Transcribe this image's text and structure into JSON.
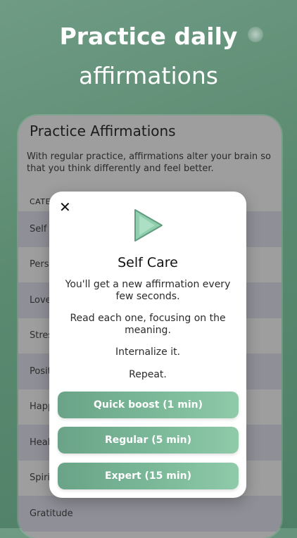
{
  "hero": {
    "line1": "Practice daily",
    "line2": "affirmations"
  },
  "screen": {
    "title": "Practice Affirmations",
    "description": "With regular practice, affirmations alter your brain so that you think differently and feel better.",
    "category_header": "CATE",
    "categories": [
      "Self C",
      "Perso",
      "Love",
      "Stres",
      "Posit",
      "Happ",
      "Heal",
      "Spiri",
      "Gratitude"
    ]
  },
  "modal": {
    "close_icon": "close-icon",
    "play_icon": "play-icon",
    "title": "Self Care",
    "text1": "You'll get a new affirmation every few seconds.",
    "text2": "Read each one, focusing on the meaning.",
    "text3": "Internalize it.",
    "text4": "Repeat.",
    "buttons": [
      "Quick boost (1 min)",
      "Regular (5 min)",
      "Expert (15 min)"
    ]
  },
  "colors": {
    "accent_start": "#6aa387",
    "accent_end": "#8fcaa9",
    "background": "#5a8a70"
  }
}
